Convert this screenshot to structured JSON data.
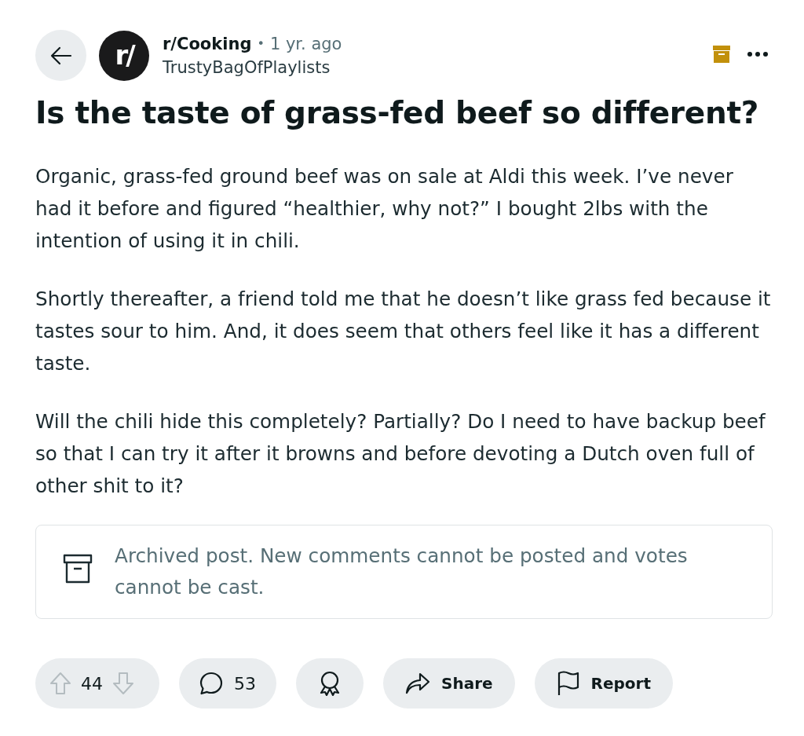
{
  "post": {
    "subreddit": "r/Cooking",
    "separator": "•",
    "age": "1 yr. ago",
    "author": "TrustyBagOfPlaylists",
    "avatar_text": "r/",
    "archived": true,
    "title": "Is the taste of grass-fed beef so different?",
    "paragraphs": [
      "Organic, grass-fed ground beef was on sale at Aldi this week. I’ve never had it before and figured “healthier, why not?” I bought 2lbs with the intention of using it in chili.",
      "Shortly thereafter, a friend told me that he doesn’t like grass fed because it tastes sour to him. And, it does seem that others feel like it has a different taste.",
      "Will the chili hide this completely? Partially? Do I need to have backup beef so that I can try it after it browns and before devoting a Dutch oven full of other shit to it?"
    ]
  },
  "notice": {
    "text": "Archived post. New comments cannot be posted and votes cannot be cast."
  },
  "actions": [
    {
      "kind": "vote",
      "count": "44",
      "disabled": true
    },
    {
      "kind": "comments",
      "count": "53"
    },
    {
      "kind": "award"
    },
    {
      "kind": "share",
      "label": "Share"
    },
    {
      "kind": "report",
      "label": "Report"
    }
  ]
}
